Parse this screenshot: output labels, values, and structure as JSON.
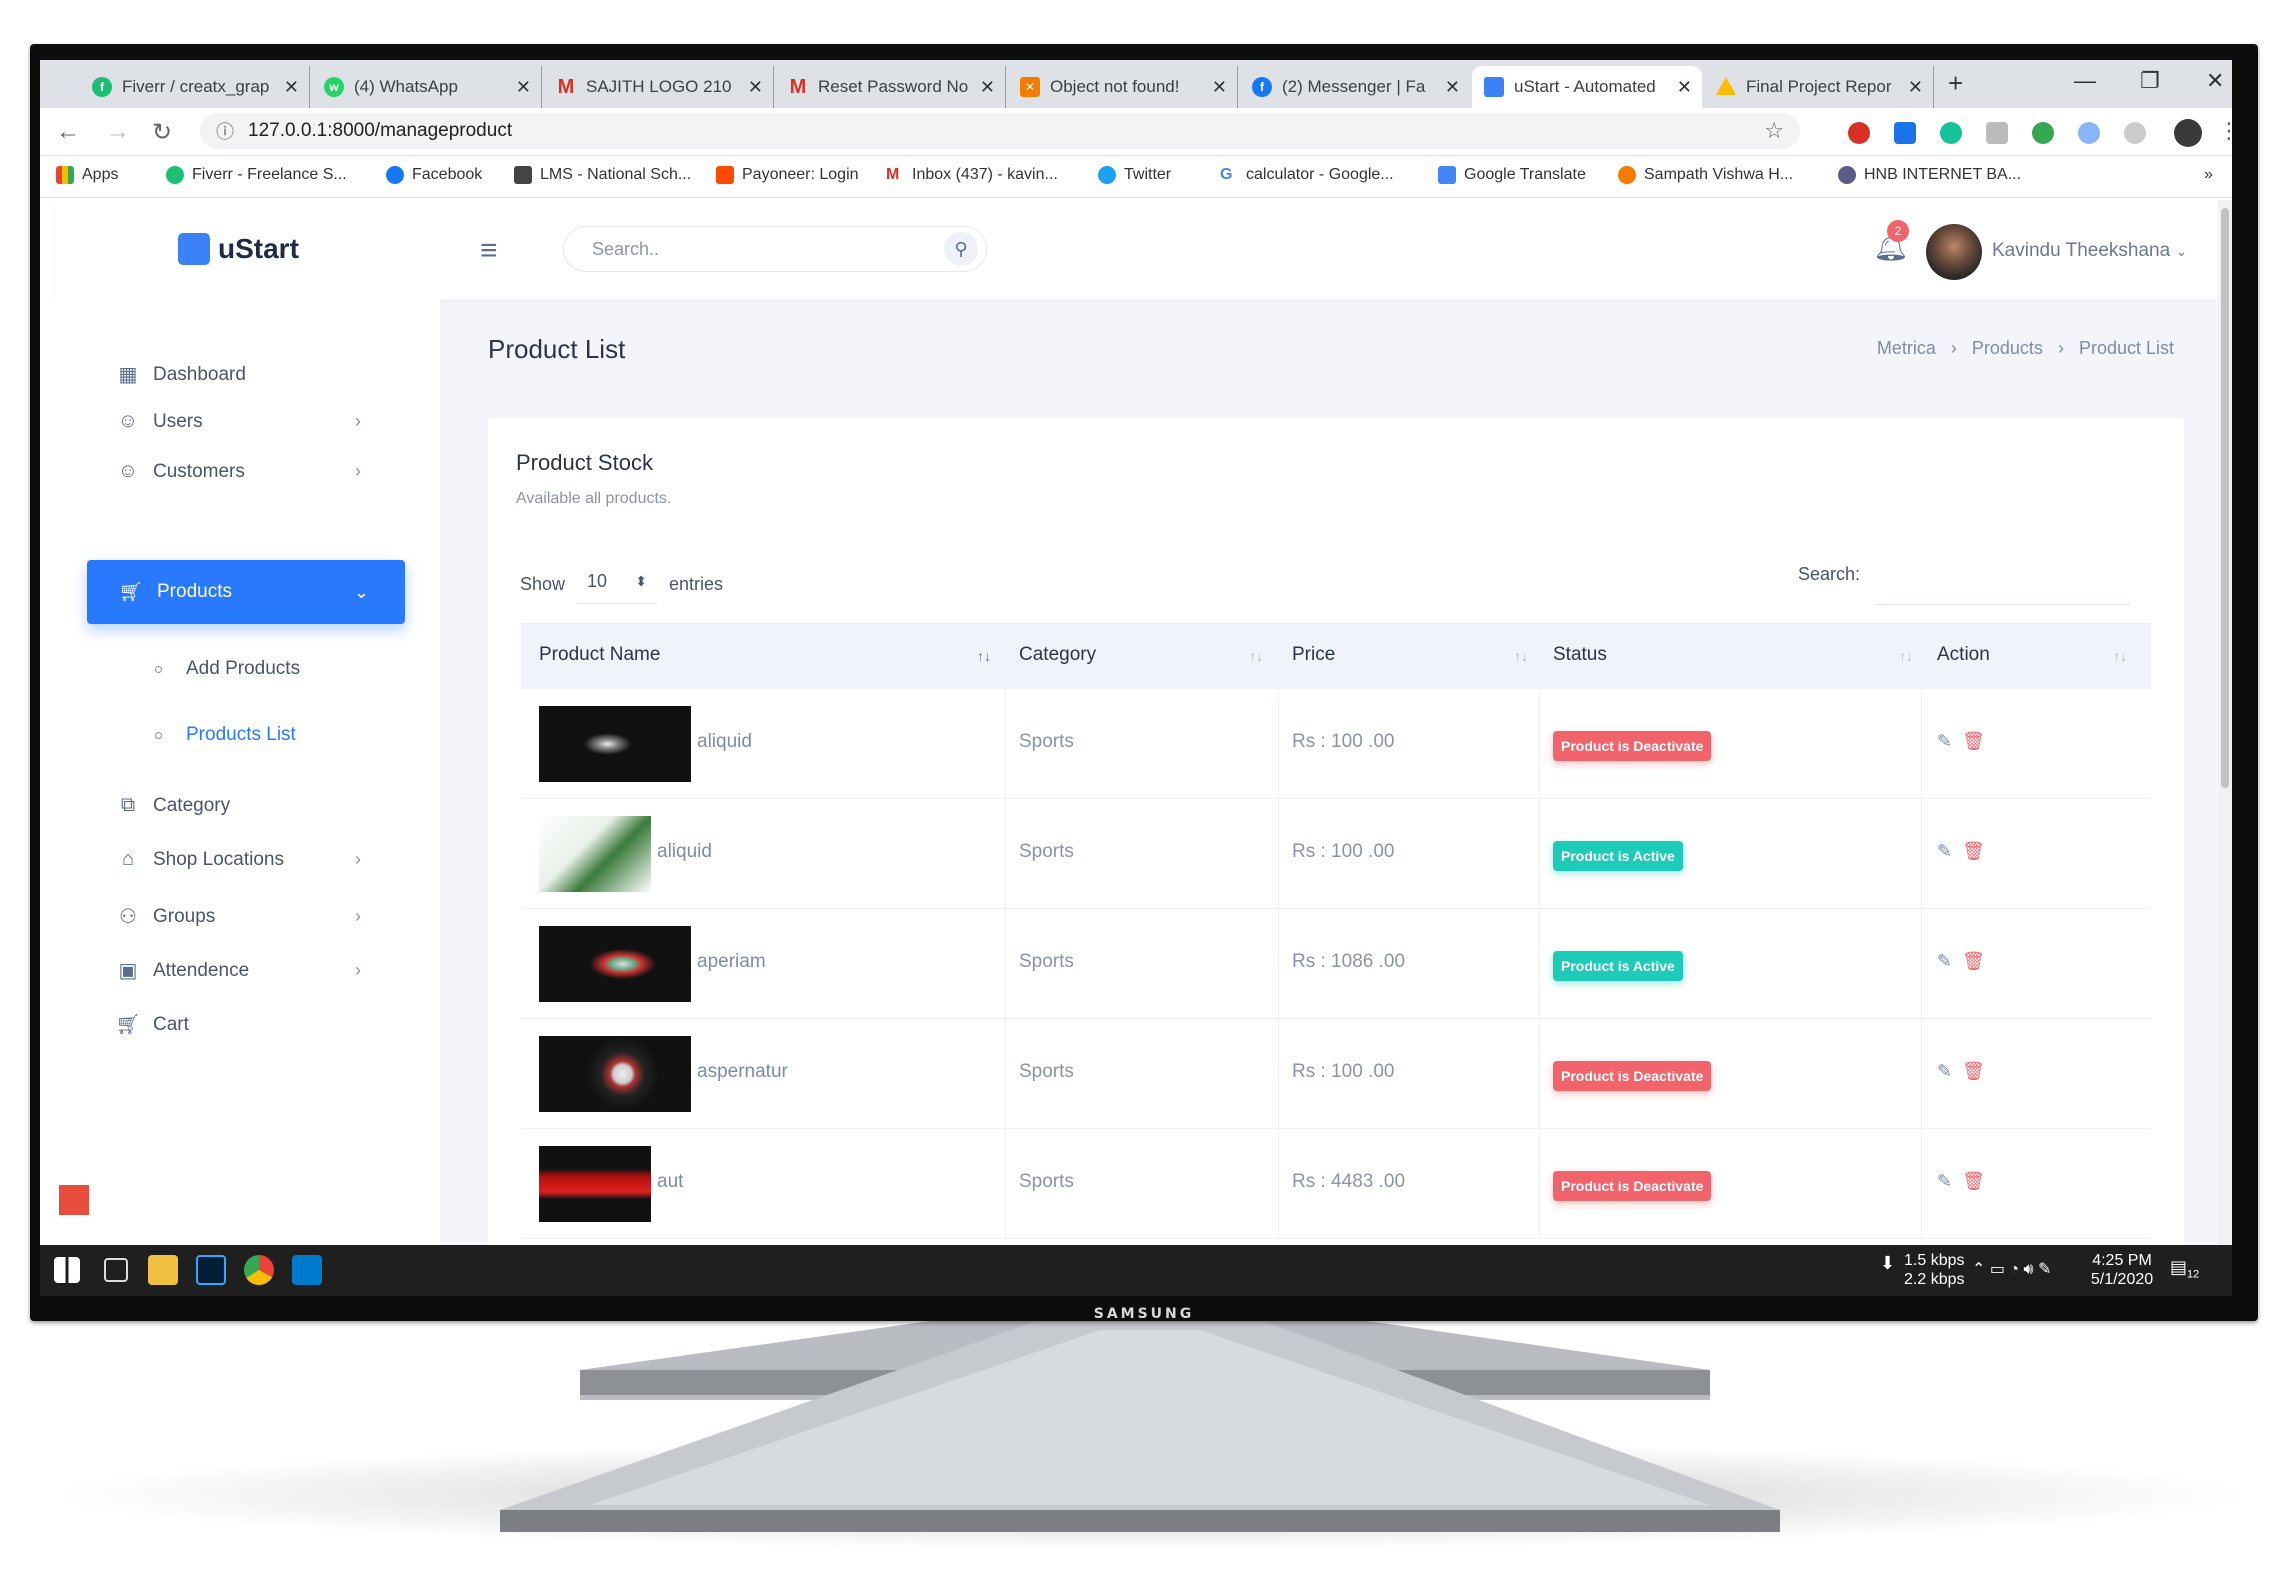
{
  "browser": {
    "tabs": [
      {
        "title": "Fiverr / creatx_grap",
        "color": "#1dbf73"
      },
      {
        "title": "(4) WhatsApp",
        "color": "#25d366"
      },
      {
        "title": "SAJITH LOGO 210",
        "color": "#d93025"
      },
      {
        "title": "Reset Password No",
        "color": "#d93025"
      },
      {
        "title": "Object not found!",
        "color": "#f57c00"
      },
      {
        "title": "(2) Messenger | Fa",
        "color": "#1877f2"
      },
      {
        "title": "uStart - Automated",
        "color": "#3c82f6"
      },
      {
        "title": "Final Project Repor",
        "color": "#fbbc04"
      }
    ],
    "url": "127.0.0.1:8000/manageproduct",
    "bookmarks": [
      "Apps",
      "Fiverr - Freelance S...",
      "Facebook",
      "LMS - National Sch...",
      "Payoneer: Login",
      "Inbox (437) - kavin...",
      "Twitter",
      "calculator - Google...",
      "Google Translate",
      "Sampath Vishwa H...",
      "HNB INTERNET BA..."
    ]
  },
  "app": {
    "brand": "uStart",
    "search_placeholder": "Search..",
    "notification_count": "2",
    "user_name": "Kavindu Theekshana",
    "sidebar": {
      "dashboard": "Dashboard",
      "users": "Users",
      "customers": "Customers",
      "products": "Products",
      "add_products": "Add Products",
      "products_list": "Products List",
      "category": "Category",
      "shop_locations": "Shop Locations",
      "groups": "Groups",
      "attendence": "Attendence",
      "cart": "Cart"
    },
    "page_title": "Product List",
    "breadcrumb": [
      "Metrica",
      "Products",
      "Product List"
    ],
    "card_title": "Product Stock",
    "card_subtitle": "Available all products.",
    "show_label": "Show",
    "entries_value": "10",
    "entries_label": "entries",
    "search_label": "Search:",
    "columns": [
      "Product Name",
      "Category",
      "Price",
      "Status",
      "Action"
    ],
    "rows": [
      {
        "name": "aliquid",
        "category": "Sports",
        "price": "Rs : 100 .00",
        "status": "Product is Deactivate"
      },
      {
        "name": "aliquid",
        "category": "Sports",
        "price": "Rs : 100 .00",
        "status": "Product is Active"
      },
      {
        "name": "aperiam",
        "category": "Sports",
        "price": "Rs : 1086 .00",
        "status": "Product is Active"
      },
      {
        "name": "aspernatur",
        "category": "Sports",
        "price": "Rs : 100 .00",
        "status": "Product is Deactivate"
      },
      {
        "name": "aut",
        "category": "Sports",
        "price": "Rs : 4483 .00",
        "status": "Product is Deactivate"
      }
    ]
  },
  "taskbar": {
    "download": "1.5 kbps",
    "upload": "2.2 kbps",
    "time": "4:25 PM",
    "date": "5/1/2020",
    "notifications": "12"
  },
  "monitor_brand": "SAMSUNG"
}
